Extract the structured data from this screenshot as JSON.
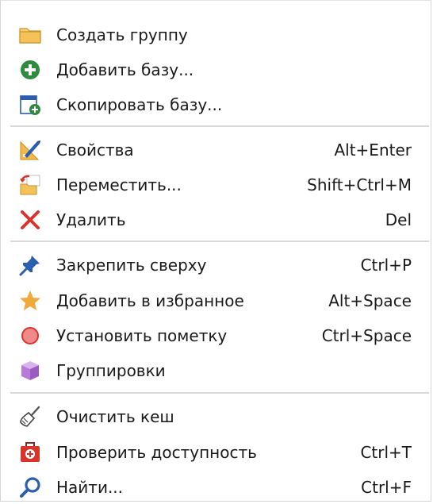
{
  "menu": {
    "groups": [
      {
        "items": [
          {
            "label": "Создать группу",
            "shortcut": "",
            "icon": "folder-icon"
          },
          {
            "label": "Добавить базу...",
            "shortcut": "",
            "icon": "add-circle-icon"
          },
          {
            "label": "Скопировать базу...",
            "shortcut": "",
            "icon": "copy-database-icon"
          }
        ]
      },
      {
        "items": [
          {
            "label": "Свойства",
            "shortcut": "Alt+Enter",
            "icon": "properties-icon"
          },
          {
            "label": "Переместить...",
            "shortcut": "Shift+Ctrl+M",
            "icon": "move-icon"
          },
          {
            "label": "Удалить",
            "shortcut": "Del",
            "icon": "delete-icon"
          }
        ]
      },
      {
        "items": [
          {
            "label": "Закрепить сверху",
            "shortcut": "Ctrl+P",
            "icon": "pin-icon"
          },
          {
            "label": "Добавить в избранное",
            "shortcut": "Alt+Space",
            "icon": "star-icon"
          },
          {
            "label": "Установить пометку",
            "shortcut": "Ctrl+Space",
            "icon": "mark-circle-icon"
          },
          {
            "label": "Группировки",
            "shortcut": "",
            "icon": "cube-icon"
          }
        ]
      },
      {
        "items": [
          {
            "label": "Очистить кеш",
            "shortcut": "",
            "icon": "broom-icon"
          },
          {
            "label": "Проверить доступность",
            "shortcut": "Ctrl+T",
            "icon": "first-aid-icon"
          },
          {
            "label": "Найти...",
            "shortcut": "Ctrl+F",
            "icon": "search-icon"
          }
        ]
      }
    ]
  },
  "colors": {
    "green": "#2e8b3e",
    "red": "#d9342b",
    "blue": "#2a5fb0",
    "star": "#f2a93b",
    "folder": "#f5c25a",
    "purple": "#b87ad8",
    "separator": "#d9d9d9"
  }
}
